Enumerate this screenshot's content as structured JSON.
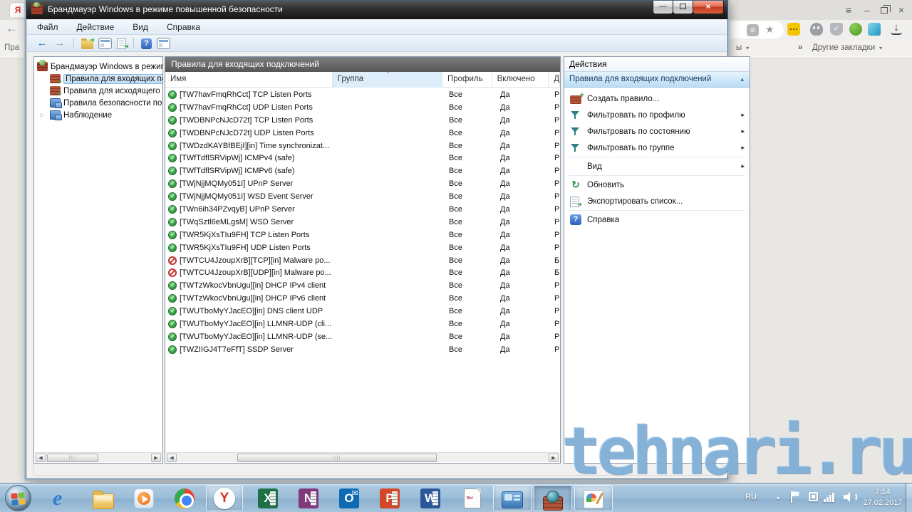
{
  "browser": {
    "tab_initial": "Я",
    "back_glyph": "←",
    "bookmark_partial_left": "Пра",
    "folder_partial": "ы",
    "overflow_chevron": "»",
    "other_bookmarks_label": "Другие закладки",
    "controls": {
      "menu": "≡",
      "minimize": "–",
      "close": "×"
    },
    "star_glyph": "★",
    "download_glyph": "↓"
  },
  "window": {
    "title": "Брандмауэр Windows в режиме повышенной безопасности",
    "menu_items": [
      "Файл",
      "Действие",
      "Вид",
      "Справка"
    ],
    "controls": {
      "minimize": "—",
      "close": "×"
    },
    "toolbar_glyphs": {
      "back": "←",
      "forward": "→",
      "help": "?"
    }
  },
  "tree": {
    "root_label": "Брандмауэр Windows в режим",
    "expand_glyph": "▷",
    "items": [
      {
        "label": "Правила для входящих под",
        "icon": "inbound-rules",
        "selected": true
      },
      {
        "label": "Правила для исходящего п",
        "icon": "outbound-rules",
        "selected": false
      },
      {
        "label": "Правила безопасности по",
        "icon": "connection-security",
        "selected": false
      },
      {
        "label": "Наблюдение",
        "icon": "monitoring",
        "selected": false,
        "expandable": true
      }
    ]
  },
  "list": {
    "panel_title": "Правила для входящих подключений",
    "columns": [
      "Имя",
      "Группа",
      "Профиль",
      "Включено",
      "Д"
    ],
    "sorted_column": "Группа",
    "sort_glyph": "ˆ",
    "rows": [
      {
        "status": "allow",
        "name": "[TW7havFmqRhCct] TCP Listen Ports",
        "profile": "Все",
        "enabled": "Да",
        "action": "Р"
      },
      {
        "status": "allow",
        "name": "[TW7havFmqRhCct] UDP Listen Ports",
        "profile": "Все",
        "enabled": "Да",
        "action": "Р"
      },
      {
        "status": "allow",
        "name": "[TWDBNPcNJcD72t] TCP Listen Ports",
        "profile": "Все",
        "enabled": "Да",
        "action": "Р"
      },
      {
        "status": "allow",
        "name": "[TWDBNPcNJcD72t] UDP Listen Ports",
        "profile": "Все",
        "enabled": "Да",
        "action": "Р"
      },
      {
        "status": "allow",
        "name": "[TWDzdKAYBfBEjI][in] Time synchronizat...",
        "profile": "Все",
        "enabled": "Да",
        "action": "Р"
      },
      {
        "status": "allow",
        "name": "[TWfTdflSRVipWj] ICMPv4 (safe)",
        "profile": "Все",
        "enabled": "Да",
        "action": "Р"
      },
      {
        "status": "allow",
        "name": "[TWfTdflSRVipWj] ICMPv6 (safe)",
        "profile": "Все",
        "enabled": "Да",
        "action": "Р"
      },
      {
        "status": "allow",
        "name": "[TWjNjjMQMy051I] UPnP Server",
        "profile": "Все",
        "enabled": "Да",
        "action": "Р"
      },
      {
        "status": "allow",
        "name": "[TWjNjjMQMy051I] WSD Event Server",
        "profile": "Все",
        "enabled": "Да",
        "action": "Р"
      },
      {
        "status": "allow",
        "name": "[TWn6ih34PZvqyB] UPnP Server",
        "profile": "Все",
        "enabled": "Да",
        "action": "Р"
      },
      {
        "status": "allow",
        "name": "[TWqSztl6eMLgsM] WSD Server",
        "profile": "Все",
        "enabled": "Да",
        "action": "Р"
      },
      {
        "status": "allow",
        "name": "[TWR5KjXsTIu9FH] TCP Listen Ports",
        "profile": "Все",
        "enabled": "Да",
        "action": "Р"
      },
      {
        "status": "allow",
        "name": "[TWR5KjXsTIu9FH] UDP Listen Ports",
        "profile": "Все",
        "enabled": "Да",
        "action": "Р"
      },
      {
        "status": "block",
        "name": "[TWTCU4JzoupXrB][TCP][in] Malware po...",
        "profile": "Все",
        "enabled": "Да",
        "action": "Б"
      },
      {
        "status": "block",
        "name": "[TWTCU4JzoupXrB][UDP][in] Malware po...",
        "profile": "Все",
        "enabled": "Да",
        "action": "Б"
      },
      {
        "status": "allow",
        "name": "[TWTzWkocVbnUgu][in] DHCP IPv4 client",
        "profile": "Все",
        "enabled": "Да",
        "action": "Р"
      },
      {
        "status": "allow",
        "name": "[TWTzWkocVbnUgu][in] DHCP IPv6 client",
        "profile": "Все",
        "enabled": "Да",
        "action": "Р"
      },
      {
        "status": "allow",
        "name": "[TWUTboMyYJacEO][in] DNS client UDP",
        "profile": "Все",
        "enabled": "Да",
        "action": "Р"
      },
      {
        "status": "allow",
        "name": "[TWUTboMyYJacEO][in] LLMNR-UDP (cli...",
        "profile": "Все",
        "enabled": "Да",
        "action": "Р"
      },
      {
        "status": "allow",
        "name": "[TWUTboMyYJacEO][in] LLMNR-UDP (se...",
        "profile": "Все",
        "enabled": "Да",
        "action": "Р"
      },
      {
        "status": "allow",
        "name": "[TWZIIGJ4T7eFfT] SSDP Server",
        "profile": "Все",
        "enabled": "Да",
        "action": "Р"
      }
    ]
  },
  "actions": {
    "header": "Действия",
    "group_title": "Правила для входящих подключений",
    "collapse_glyph": "▴",
    "submenu_glyph": "▸",
    "items": [
      {
        "label": "Создать правило...",
        "icon": "new-rule",
        "submenu": false,
        "separator_before": false
      },
      {
        "label": "Фильтровать по профилю",
        "icon": "filter",
        "submenu": true,
        "separator_before": false
      },
      {
        "label": "Фильтровать по состоянию",
        "icon": "filter",
        "submenu": true,
        "separator_before": false
      },
      {
        "label": "Фильтровать по группе",
        "icon": "filter",
        "submenu": true,
        "separator_before": false
      },
      {
        "label": "Вид",
        "icon": "none",
        "submenu": true,
        "separator_before": true
      },
      {
        "label": "Обновить",
        "icon": "refresh",
        "submenu": false,
        "separator_before": true
      },
      {
        "label": "Экспортировать список...",
        "icon": "export",
        "submenu": false,
        "separator_before": false
      },
      {
        "label": "Справка",
        "icon": "help",
        "submenu": false,
        "separator_before": true
      }
    ]
  },
  "taskbar": {
    "language": "RU",
    "hidden_icons_glyph": "▴",
    "time": "7:14",
    "date": "27.02.2017"
  },
  "watermark": "tehnari.ru"
}
